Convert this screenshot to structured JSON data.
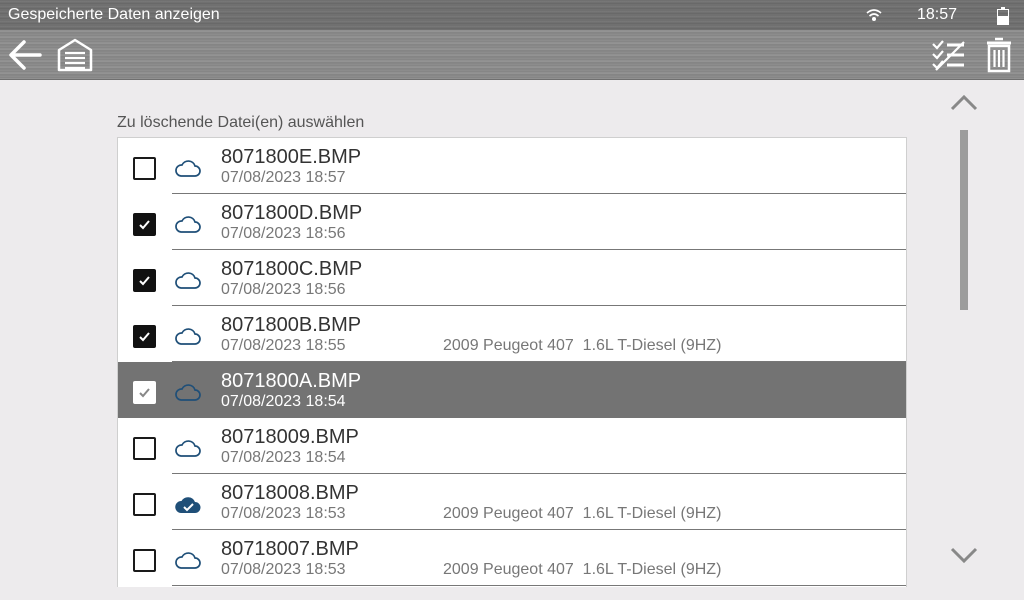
{
  "statusbar": {
    "title": "Gespeicherte Daten anzeigen",
    "time": "18:57",
    "wifi_icon": "wifi-icon",
    "battery_icon": "battery-icon"
  },
  "toolbar": {
    "back_icon": "back-arrow-icon",
    "home_icon": "garage-home-icon",
    "select_all_icon": "select-all-icon",
    "delete_icon": "trash-icon"
  },
  "instruction": "Zu löschende Datei(en) auswählen",
  "files": [
    {
      "name": "8071800E.BMP",
      "date": "07/08/2023 18:57",
      "vehicle": "",
      "checked": false,
      "selected": false,
      "cloud": "cloud-outline-icon"
    },
    {
      "name": "8071800D.BMP",
      "date": "07/08/2023 18:56",
      "vehicle": "",
      "checked": true,
      "selected": false,
      "cloud": "cloud-outline-icon"
    },
    {
      "name": "8071800C.BMP",
      "date": "07/08/2023 18:56",
      "vehicle": "",
      "checked": true,
      "selected": false,
      "cloud": "cloud-outline-icon"
    },
    {
      "name": "8071800B.BMP",
      "date": "07/08/2023 18:55",
      "vehicle": "2009 Peugeot 407  1.6L T-Diesel (9HZ)",
      "checked": true,
      "selected": false,
      "cloud": "cloud-outline-icon"
    },
    {
      "name": "8071800A.BMP",
      "date": "07/08/2023 18:54",
      "vehicle": "",
      "checked": true,
      "selected": true,
      "cloud": "cloud-outline-icon"
    },
    {
      "name": "80718009.BMP",
      "date": "07/08/2023 18:54",
      "vehicle": "",
      "checked": false,
      "selected": false,
      "cloud": "cloud-outline-icon"
    },
    {
      "name": "80718008.BMP",
      "date": "07/08/2023 18:53",
      "vehicle": "2009 Peugeot 407  1.6L T-Diesel (9HZ)",
      "checked": false,
      "selected": false,
      "cloud": "cloud-uploaded-icon"
    },
    {
      "name": "80718007.BMP",
      "date": "07/08/2023 18:53",
      "vehicle": "2009 Peugeot 407  1.6L T-Diesel (9HZ)",
      "checked": false,
      "selected": false,
      "cloud": "cloud-outline-icon"
    }
  ],
  "scroll": {
    "up_icon": "chevron-up-icon",
    "down_icon": "chevron-down-icon",
    "thumb_fraction": 0.45
  },
  "colors": {
    "cloud_blue": "#1f4f78",
    "selected_row": "#737373"
  }
}
